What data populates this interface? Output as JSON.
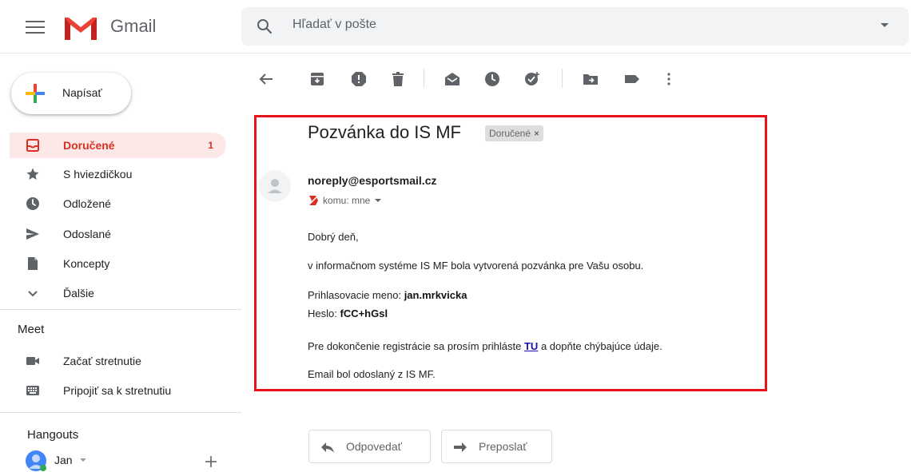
{
  "app": {
    "name": "Gmail"
  },
  "search": {
    "placeholder": "Hľadať v pošte"
  },
  "compose": {
    "label": "Napísať"
  },
  "nav": {
    "items": [
      {
        "label": "Doručené",
        "count": "1",
        "icon": "inbox-icon"
      },
      {
        "label": "S hviezdičkou",
        "icon": "star-icon"
      },
      {
        "label": "Odložené",
        "icon": "clock-icon"
      },
      {
        "label": "Odoslané",
        "icon": "send-icon"
      },
      {
        "label": "Koncepty",
        "icon": "draft-icon"
      },
      {
        "label": "Ďalšie",
        "icon": "chevron-down-icon"
      }
    ]
  },
  "meet": {
    "title": "Meet",
    "items": [
      {
        "label": "Začať stretnutie",
        "icon": "video-camera-icon"
      },
      {
        "label": "Pripojiť sa k stretnutiu",
        "icon": "keyboard-icon"
      }
    ]
  },
  "hangouts": {
    "title": "Hangouts",
    "user": "Jan"
  },
  "message": {
    "subject": "Pozvánka do IS MF",
    "label": "Doručené",
    "label_close": "×",
    "sender": "noreply@esportsmail.cz",
    "recipients": "komu: mne",
    "greeting": "Dobrý deň,",
    "line1": "v informačnom systéme IS MF bola vytvorená pozvánka pre Vašu osobu.",
    "login_label": "Prihlasovacie meno:",
    "login_value": "jan.mrkvicka",
    "password_label": "Heslo:",
    "password_value": "fCC+hGsl",
    "line3_before": "Pre dokončenie registrácie sa prosím prihláste",
    "link_text": "TU",
    "line3_after": "a dopňte chýbajúce údaje.",
    "footer": "Email bol odoslaný z IS MF."
  },
  "actions": {
    "reply": "Odpovedať",
    "forward": "Preposlať"
  },
  "colors": {
    "accent_red": "#d93025",
    "frame_red": "#e8141c",
    "link_blue": "#1a0dab"
  }
}
